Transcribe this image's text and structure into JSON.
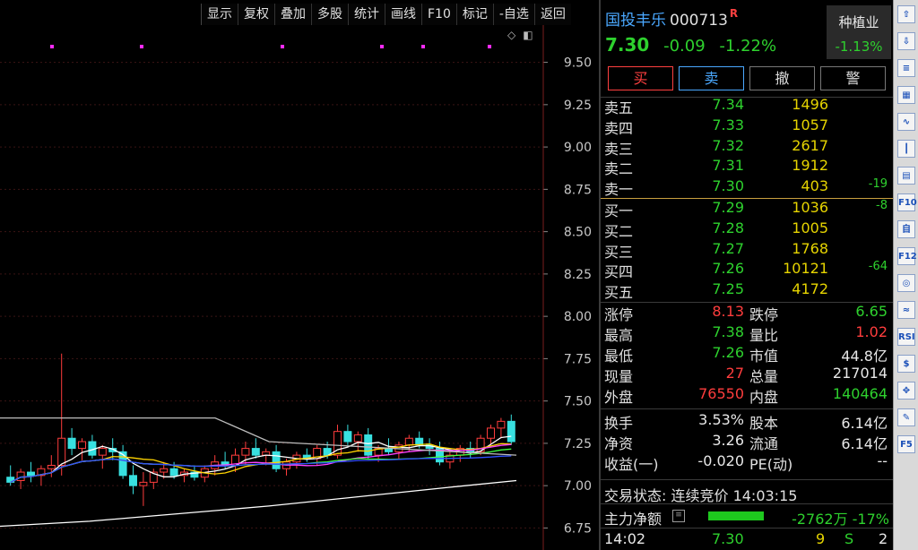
{
  "toolbar": [
    "显示",
    "复权",
    "叠加",
    "多股",
    "统计",
    "画线",
    "F10",
    "标记",
    "-自选",
    "返回"
  ],
  "stock": {
    "name": "国投丰乐",
    "code": "000713",
    "badge": "R",
    "price": "7.30",
    "change": "-0.09",
    "change_pct": "-1.22%"
  },
  "sector": {
    "name": "种植业",
    "change_pct": "-1.13%"
  },
  "trade_buttons": {
    "buy": "买",
    "sell": "卖",
    "cancel": "撤",
    "alert": "警"
  },
  "asks": [
    {
      "label": "卖五",
      "price": "7.34",
      "volume": "1496",
      "chg": ""
    },
    {
      "label": "卖四",
      "price": "7.33",
      "volume": "1057",
      "chg": ""
    },
    {
      "label": "卖三",
      "price": "7.32",
      "volume": "2617",
      "chg": ""
    },
    {
      "label": "卖二",
      "price": "7.31",
      "volume": "1912",
      "chg": ""
    },
    {
      "label": "卖一",
      "price": "7.30",
      "volume": "403",
      "chg": "-19"
    }
  ],
  "bids": [
    {
      "label": "买一",
      "price": "7.29",
      "volume": "1036",
      "chg": "-8"
    },
    {
      "label": "买二",
      "price": "7.28",
      "volume": "1005",
      "chg": ""
    },
    {
      "label": "买三",
      "price": "7.27",
      "volume": "1768",
      "chg": ""
    },
    {
      "label": "买四",
      "price": "7.26",
      "volume": "10121",
      "chg": "-64"
    },
    {
      "label": "买五",
      "price": "7.25",
      "volume": "4172",
      "chg": ""
    }
  ],
  "stats": [
    {
      "l1": "涨停",
      "v1": "8.13",
      "c1": "red",
      "l2": "跌停",
      "v2": "6.65",
      "c2": "green"
    },
    {
      "l1": "最高",
      "v1": "7.38",
      "c1": "green",
      "l2": "量比",
      "v2": "1.02",
      "c2": "red"
    },
    {
      "l1": "最低",
      "v1": "7.26",
      "c1": "green",
      "l2": "市值",
      "v2": "44.8亿",
      "c2": "white"
    },
    {
      "l1": "现量",
      "v1": "27",
      "c1": "red",
      "l2": "总量",
      "v2": "217014",
      "c2": "white"
    },
    {
      "l1": "外盘",
      "v1": "76550",
      "c1": "red",
      "l2": "内盘",
      "v2": "140464",
      "c2": "green"
    }
  ],
  "stats2": [
    {
      "l1": "换手",
      "v1": "3.53%",
      "c1": "white",
      "l2": "股本",
      "v2": "6.14亿",
      "c2": "white"
    },
    {
      "l1": "净资",
      "v1": "3.26",
      "c1": "white",
      "l2": "流通",
      "v2": "6.14亿",
      "c2": "white"
    },
    {
      "l1": "收益(一)",
      "v1": "-0.020",
      "c1": "white",
      "l2": "PE(动)",
      "v2": "--",
      "c2": "white"
    }
  ],
  "trade_status": "交易状态: 连续竞价 14:03:15",
  "main_flow": {
    "label": "主力净额",
    "value": "-2762万 -17%"
  },
  "last_tick": {
    "time": "14:02",
    "price": "7.30",
    "volume": "9",
    "side": "S",
    "count": "2"
  },
  "rail_icons": [
    "arrow-up-icon",
    "arrow-down-icon",
    "list-icon",
    "grid-icon",
    "line-chart-icon",
    "candle-icon",
    "doc-icon",
    "f10-icon",
    "self-select-icon",
    "f12-icon",
    "refresh-icon",
    "wave-icon",
    "rsi-icon",
    "dollar-icon",
    "move-icon",
    "pencil-icon",
    "f5-icon"
  ],
  "rail_labels": [
    "⇧",
    "⇩",
    "≡",
    "▦",
    "∿",
    "┃",
    "▤",
    "F10",
    "自",
    "F12",
    "◎",
    "≈",
    "RSI",
    "$",
    "✥",
    "✎",
    "F5"
  ],
  "chart_data": {
    "type": "candlestick",
    "y_ticks": [
      "9.50",
      "9.25",
      "9.00",
      "8.75",
      "8.50",
      "8.25",
      "8.00",
      "7.75",
      "7.50",
      "7.25",
      "7.00",
      "6.75"
    ],
    "ylim": [
      6.62,
      9.72
    ],
    "grid": true,
    "candles": [
      [
        7.05,
        7.12,
        7.0,
        7.02
      ],
      [
        7.03,
        7.1,
        6.98,
        7.08
      ],
      [
        7.08,
        7.14,
        7.02,
        7.06
      ],
      [
        7.06,
        7.12,
        7.0,
        7.1
      ],
      [
        7.1,
        7.18,
        7.05,
        7.12
      ],
      [
        7.12,
        7.78,
        7.06,
        7.28
      ],
      [
        7.28,
        7.34,
        7.18,
        7.22
      ],
      [
        7.22,
        7.28,
        7.15,
        7.26
      ],
      [
        7.26,
        7.3,
        7.16,
        7.18
      ],
      [
        7.18,
        7.24,
        7.1,
        7.22
      ],
      [
        7.22,
        7.28,
        7.15,
        7.2
      ],
      [
        7.2,
        7.24,
        7.04,
        7.06
      ],
      [
        7.06,
        7.12,
        6.95,
        7.0
      ],
      [
        7.0,
        7.08,
        6.88,
        7.02
      ],
      [
        7.02,
        7.1,
        6.98,
        7.08
      ],
      [
        7.08,
        7.14,
        7.04,
        7.1
      ],
      [
        7.1,
        7.14,
        7.04,
        7.06
      ],
      [
        7.06,
        7.1,
        7.02,
        7.08
      ],
      [
        7.08,
        7.12,
        7.03,
        7.05
      ],
      [
        7.05,
        7.12,
        7.02,
        7.1
      ],
      [
        7.1,
        7.18,
        7.06,
        7.14
      ],
      [
        7.14,
        7.2,
        7.1,
        7.12
      ],
      [
        7.12,
        7.22,
        7.08,
        7.18
      ],
      [
        7.18,
        7.26,
        7.12,
        7.22
      ],
      [
        7.22,
        7.28,
        7.16,
        7.18
      ],
      [
        7.18,
        7.22,
        7.12,
        7.2
      ],
      [
        7.2,
        7.24,
        7.08,
        7.1
      ],
      [
        7.1,
        7.16,
        7.06,
        7.14
      ],
      [
        7.14,
        7.2,
        7.1,
        7.18
      ],
      [
        7.18,
        7.22,
        7.14,
        7.16
      ],
      [
        7.16,
        7.24,
        7.12,
        7.22
      ],
      [
        7.22,
        7.26,
        7.16,
        7.18
      ],
      [
        7.18,
        7.36,
        7.16,
        7.32
      ],
      [
        7.32,
        7.36,
        7.24,
        7.26
      ],
      [
        7.26,
        7.32,
        7.2,
        7.3
      ],
      [
        7.3,
        7.34,
        7.16,
        7.18
      ],
      [
        7.18,
        7.24,
        7.14,
        7.22
      ],
      [
        7.22,
        7.28,
        7.18,
        7.2
      ],
      [
        7.2,
        7.26,
        7.16,
        7.24
      ],
      [
        7.24,
        7.3,
        7.2,
        7.28
      ],
      [
        7.28,
        7.32,
        7.22,
        7.24
      ],
      [
        7.24,
        7.28,
        7.18,
        7.22
      ],
      [
        7.22,
        7.26,
        7.12,
        7.14
      ],
      [
        7.14,
        7.2,
        7.1,
        7.18
      ],
      [
        7.18,
        7.24,
        7.14,
        7.22
      ],
      [
        7.22,
        7.26,
        7.16,
        7.2
      ],
      [
        7.2,
        7.3,
        7.18,
        7.28
      ],
      [
        7.28,
        7.36,
        7.24,
        7.34
      ],
      [
        7.34,
        7.4,
        7.28,
        7.38
      ],
      [
        7.38,
        7.42,
        7.24,
        7.26
      ]
    ]
  }
}
